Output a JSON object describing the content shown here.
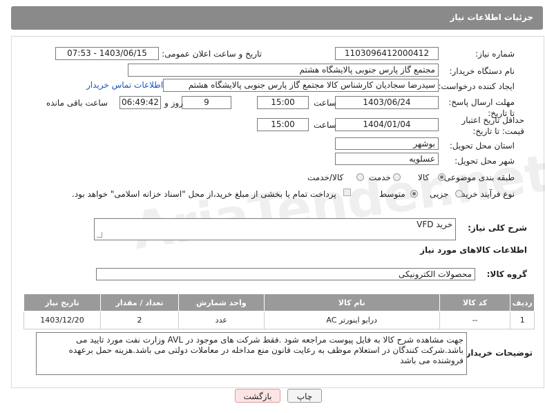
{
  "header": {
    "title": "جزئیات اطلاعات نیاز"
  },
  "form": {
    "need_number_label": "شماره نیاز:",
    "need_number": "1103096412000412",
    "announce_label": "تاریخ و ساعت اعلان عمومی:",
    "announce_value": "1403/06/15 - 07:53",
    "buyer_org_label": "نام دستگاه خریدار:",
    "buyer_org": "مجتمع گاز پارس جنوبی  پالایشگاه هشتم",
    "creator_label": "ایجاد کننده درخواست:",
    "creator": "سیدرضا سجادیان کارشناس کالا مجتمع گاز پارس جنوبی  پالایشگاه هشتم",
    "buyer_contact_link": "اطلاعات تماس خریدار",
    "reply_deadline_label": "مهلت ارسال پاسخ: تا تاریخ:",
    "reply_date": "1403/06/24",
    "time_label": "ساعت",
    "reply_time": "15:00",
    "days_value": "9",
    "days_label": "روز و",
    "remaining_time": "06:49:42",
    "remaining_label": "ساعت باقی مانده",
    "price_validity_label": "حداقل تاریخ اعتبار قیمت: تا تاریخ:",
    "price_date": "1404/01/04",
    "price_time": "15:00",
    "province_label": "استان محل تحویل:",
    "province": "بوشهر",
    "city_label": "شهر محل تحویل:",
    "city": "عسلویه",
    "category_label": "طبقه بندی موضوعی:",
    "category_options": [
      "کالا",
      "خدمت",
      "کالا/خدمت"
    ],
    "process_label": "نوع فرآیند خرید :",
    "process_options": [
      "جزیی",
      "متوسط"
    ],
    "payment_note": "پرداخت تمام یا بخشی از مبلغ خرید،از محل \"اسناد خزانه اسلامی\" خواهد بود."
  },
  "description": {
    "label": "شرح کلی نیاز:",
    "value": "خرید VFD"
  },
  "goods_section_title": "اطلاعات کالاهای مورد نیاز",
  "goods_group": {
    "label": "گروه کالا:",
    "value": "محصولات الکترونیکی"
  },
  "table": {
    "headers": [
      "ردیف",
      "کد کالا",
      "نام کالا",
      "واحد شمارش",
      "تعداد / مقدار",
      "تاریخ نیاز"
    ],
    "rows": [
      [
        "1",
        "--",
        "درایو اینورتر AC",
        "عدد",
        "2",
        "1403/12/20"
      ]
    ]
  },
  "buyer_notes": {
    "label": "توضیحات خریدار:",
    "value": "جهت مشاهده شرح کالا به فایل پیوست مراجعه شود .فقط شرکت های موجود در AVL وزارت نفت مورد تایید می باشد.شرکت کنندگان در استعلام موظف به رعایت قانون منع مداخله در معاملات دولتی می باشد.هزینه حمل برعهده فروشنده می باشد"
  },
  "buttons": {
    "print": "چاپ",
    "back": "بازگشت"
  },
  "watermark": "AriaTender.net"
}
